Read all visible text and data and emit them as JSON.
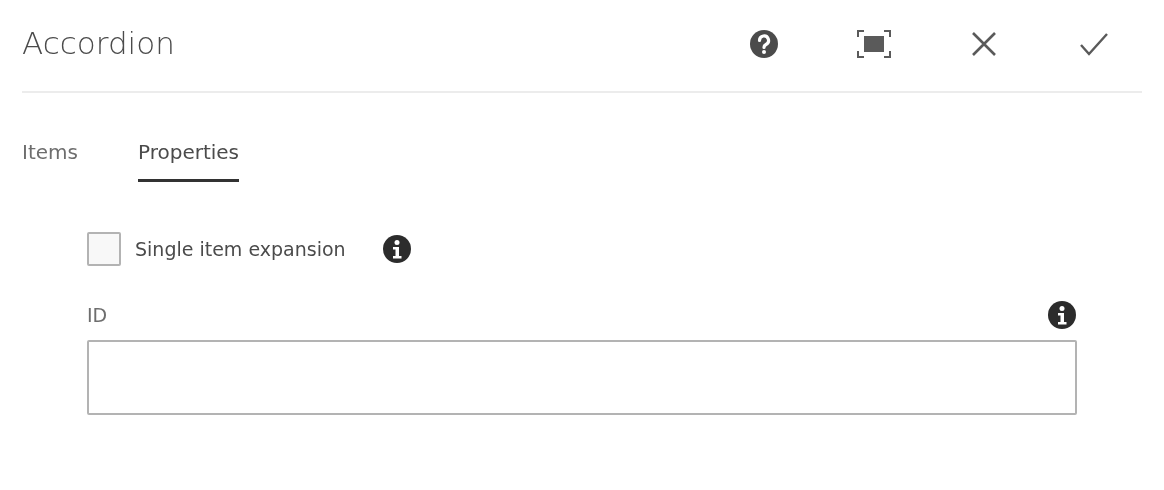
{
  "dialog": {
    "title": "Accordion"
  },
  "toolbar": [
    {
      "kind": "help"
    },
    {
      "kind": "fullscreen"
    },
    {
      "kind": "close"
    },
    {
      "kind": "done"
    }
  ],
  "tabs": [
    {
      "label": "Items",
      "selected": false
    },
    {
      "label": "Properties",
      "selected": true
    }
  ],
  "fields": [
    {
      "kind": "checkbox",
      "label": "Single item expansion",
      "checked": false,
      "info": true
    },
    {
      "kind": "text",
      "label": "ID",
      "info": true
    }
  ]
}
